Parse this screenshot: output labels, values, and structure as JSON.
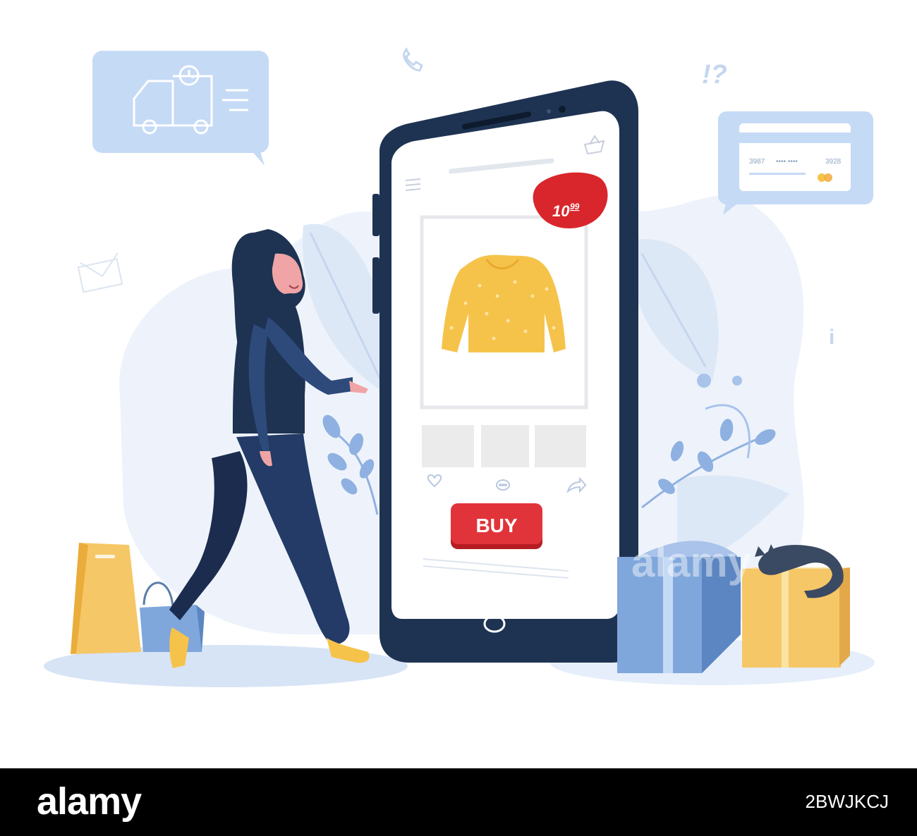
{
  "phone": {
    "price_main": "10",
    "price_cents": "99",
    "buy_label": "BUY"
  },
  "card_bubble": {
    "number_left": "3987",
    "number_right": "3928"
  },
  "watermark": {
    "text": "alamy"
  },
  "footer": {
    "brand": "alamy",
    "image_id": "2BWJKCJ"
  },
  "colors": {
    "phone_body": "#1e3352",
    "screen": "#ffffff",
    "price_badge": "#d9262c",
    "buy_button": "#d9262c",
    "sweater": "#f6c34a",
    "bubble": "#c5daf5",
    "accent_blue": "#7fa7dc",
    "box_yellow": "#f6c767",
    "footer_bg": "#000000"
  },
  "icons": [
    "truck-icon",
    "clock-icon",
    "credit-card-icon",
    "envelope-icon",
    "phone-handset-icon",
    "exclamation-question-icon",
    "info-icon",
    "menu-icon",
    "basket-icon",
    "heart-icon",
    "chat-icon",
    "share-icon",
    "home-button-icon",
    "cat-icon"
  ]
}
